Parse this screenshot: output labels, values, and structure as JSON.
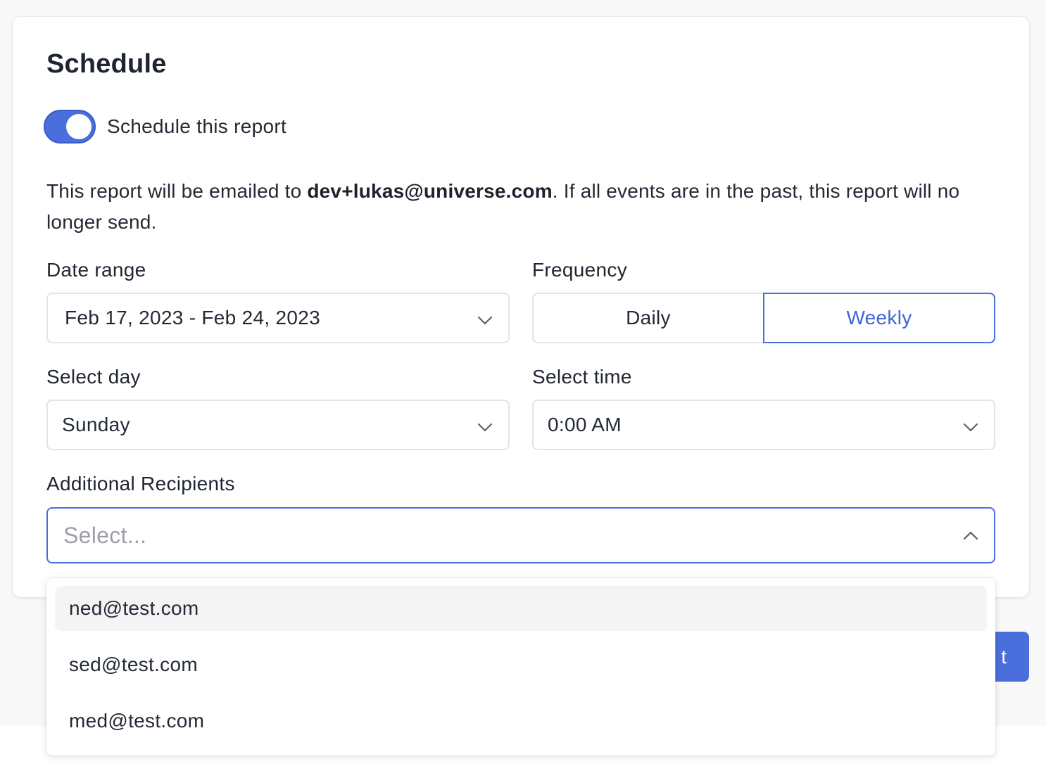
{
  "title": "Schedule",
  "toggle": {
    "label": "Schedule this report",
    "enabled": true
  },
  "info": {
    "prefix": "This report will be emailed to ",
    "email": "dev+lukas@universe.com",
    "suffix": ". If all events are in the past, this report will no longer send."
  },
  "date_range": {
    "label": "Date range",
    "value": "Feb 17, 2023 - Feb 24, 2023",
    "icon": "chevron-down-icon"
  },
  "frequency": {
    "label": "Frequency",
    "options": [
      "Daily",
      "Weekly"
    ],
    "selected": "Weekly",
    "accent": "#4a6fdc"
  },
  "select_day": {
    "label": "Select day",
    "value": "Sunday",
    "icon": "chevron-down-icon"
  },
  "select_time": {
    "label": "Select time",
    "value": "0:00 AM",
    "icon": "chevron-down-icon"
  },
  "recipients": {
    "label": "Additional Recipients",
    "placeholder": "Select...",
    "icon": "chevron-up-icon",
    "options": [
      "ned@test.com",
      "sed@test.com",
      "med@test.com"
    ],
    "highlighted": "ned@test.com"
  },
  "background_button": {
    "label": "t"
  }
}
